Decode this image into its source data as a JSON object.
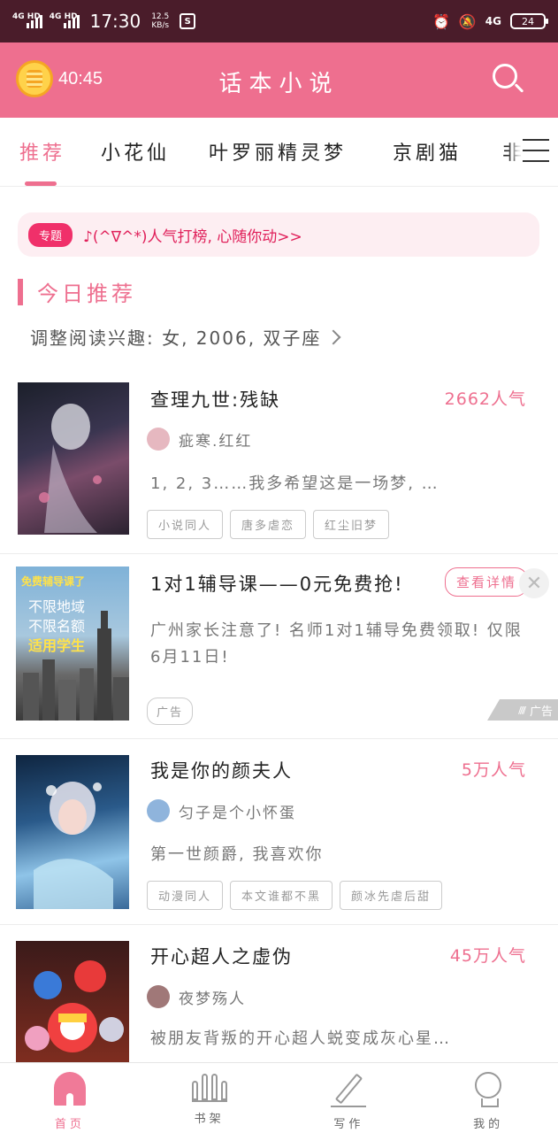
{
  "status_bar": {
    "sim1": "4G HD",
    "sim2": "4G HD",
    "time": "17:30",
    "speed_value": "12.5",
    "speed_unit": "KB/s",
    "network": "4G",
    "battery": "24"
  },
  "header": {
    "coin_timer": "40:45",
    "title": "话本小说"
  },
  "tabs": [
    {
      "label": "推荐",
      "active": true
    },
    {
      "label": "小花仙"
    },
    {
      "label": "叶罗丽精灵梦"
    },
    {
      "label": "京剧猫"
    },
    {
      "label": "非"
    }
  ],
  "topic": {
    "badge": "专题",
    "text": "♪(^∇^*)人气打榜, 心随你动>>"
  },
  "section": {
    "title": "今日推荐",
    "preference": "调整阅读兴趣: 女, 2006, 双子座"
  },
  "items": [
    {
      "title": "查理九世:残缺",
      "popularity": "2662人气",
      "author": "疵寒.红红",
      "summary": "1, 2, 3……我多希望这是一场梦, …",
      "tags": [
        "小说同人",
        "唐多虐恋",
        "红尘旧梦"
      ]
    },
    {
      "title": "我是你的颜夫人",
      "popularity": "5万人气",
      "author": "匀子是个小怀蛋",
      "summary": "第一世颜爵, 我喜欢你",
      "tags": [
        "动漫同人",
        "本文谁都不黑",
        "颜冰先虐后甜"
      ]
    },
    {
      "title": "开心超人之虚伪",
      "popularity": "45万人气",
      "author": "夜梦殇人",
      "summary": "被朋友背叛的开心超人蜕变成灰心星…",
      "tags": []
    }
  ],
  "ad": {
    "title": "1对1辅导课——0元免费抢!",
    "button": "查看详情",
    "close": "✕",
    "description": "广州家长注意了! 名师1对1辅导免费领取! 仅限6月11日!",
    "tag": "广告",
    "corner_label": "广告",
    "cover_lines": [
      "免费辅导课了",
      "不限地域",
      "不限名额",
      "适用学生"
    ]
  },
  "bottom_nav": [
    {
      "label": "首页",
      "active": true
    },
    {
      "label": "书架"
    },
    {
      "label": "写作"
    },
    {
      "label": "我的"
    }
  ],
  "colors": {
    "brand": "#ee6f8f",
    "status_bar": "#4a1c2a"
  }
}
